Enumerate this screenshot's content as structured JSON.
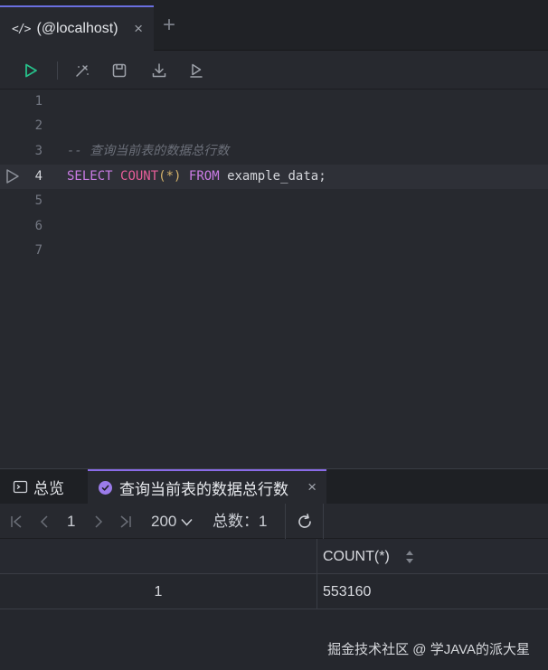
{
  "tab": {
    "label": "(@localhost)",
    "code_icon": "</>",
    "close": "×",
    "new_tab": "+"
  },
  "toolbar": {
    "buttons": [
      "run-icon",
      "format-icon",
      "save-icon",
      "download-icon",
      "explain-icon"
    ],
    "accent": "#27c08a"
  },
  "editor": {
    "lines": [
      {
        "num": "1"
      },
      {
        "num": "2"
      },
      {
        "num": "3",
        "comment": "-- 查询当前表的数据总行数"
      },
      {
        "num": "4",
        "kw1": "SELECT",
        "fn": "COUNT",
        "args": "(*)",
        "kw2": "FROM",
        "ident": "example_data;"
      },
      {
        "num": "5"
      },
      {
        "num": "6"
      },
      {
        "num": "7"
      }
    ]
  },
  "results": {
    "tabs": [
      {
        "label": "总览",
        "icon": "console-icon"
      },
      {
        "label": "查询当前表的数据总行数",
        "icon": "check-circle-icon",
        "close": "×"
      }
    ],
    "pager": {
      "page": "1",
      "page_size": "200",
      "total_label": "总数：",
      "total": "1"
    },
    "columns": [
      "COUNT(*)"
    ],
    "rows": [
      {
        "num": "1",
        "value": "553160"
      }
    ]
  },
  "watermark": "掘金技术社区 @ 学JAVA的派大星"
}
